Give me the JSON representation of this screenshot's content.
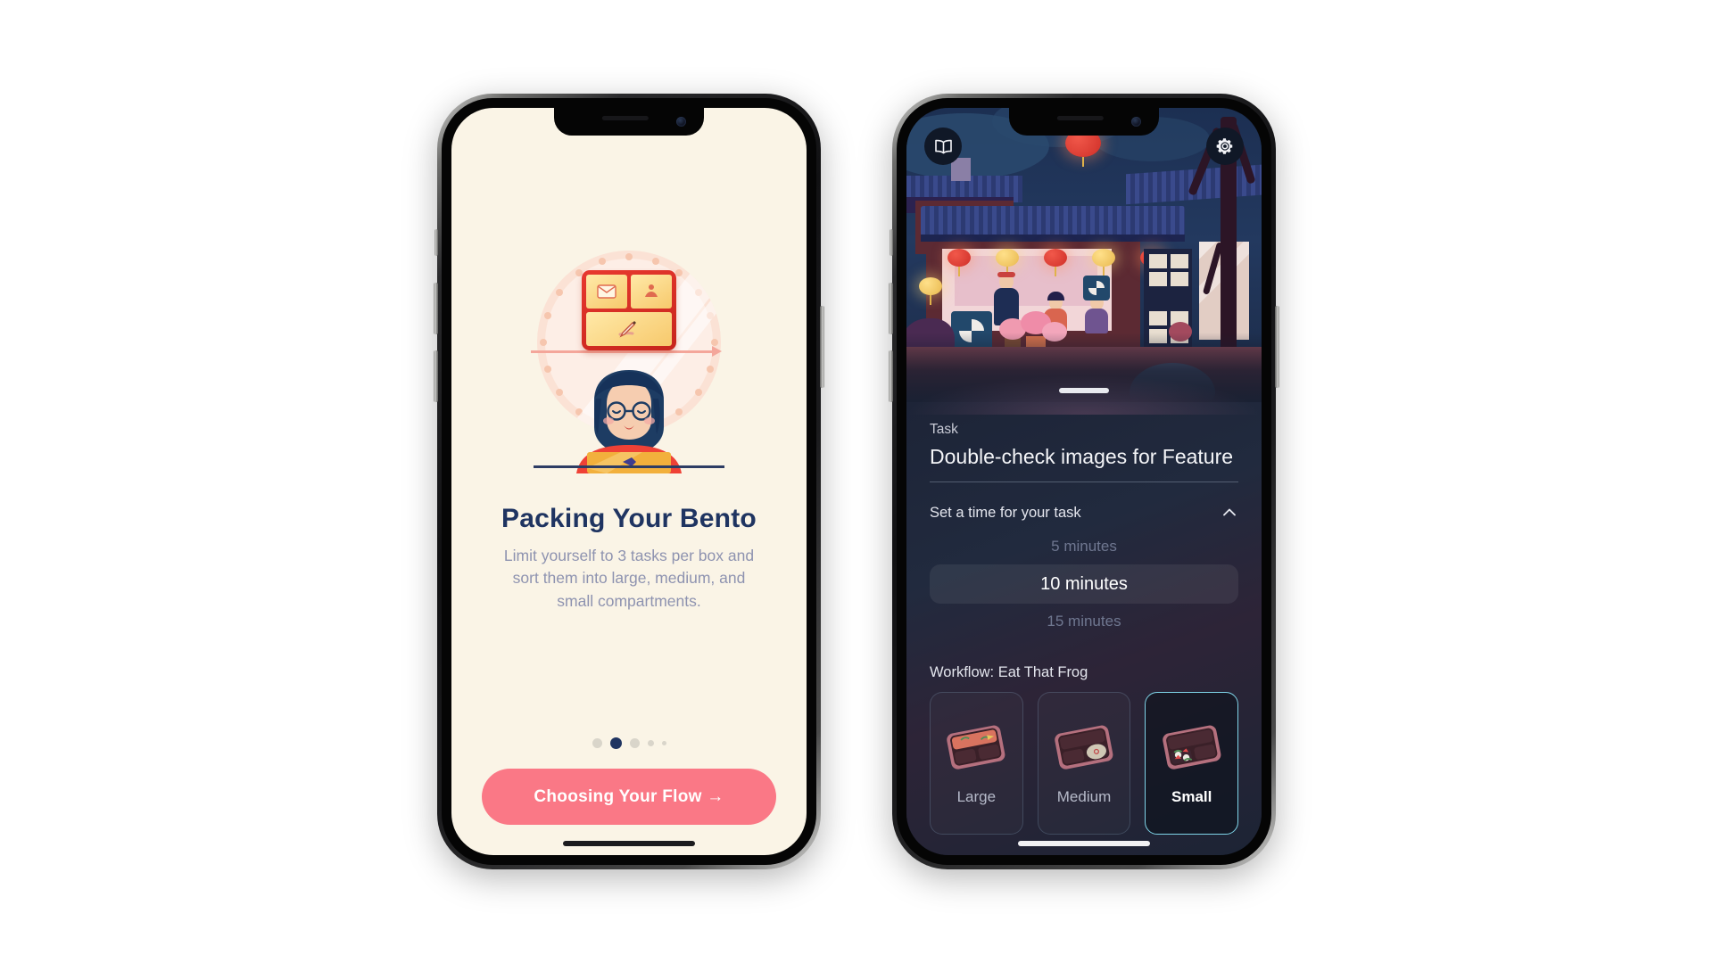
{
  "onboarding": {
    "title": "Packing Your Bento",
    "body": "Limit yourself to 3 tasks per box and sort them into large, medium, and small compartments.",
    "cta_label": "Choosing Your Flow  →",
    "pagination": {
      "total": 5,
      "active_index": 1,
      "dot_sizes": [
        11,
        13,
        11,
        7,
        5
      ]
    },
    "colors": {
      "background": "#faf4e6",
      "title": "#1f3461",
      "body": "#8e93b0",
      "cta_background": "#fa7886",
      "cta_text": "#ffffff",
      "dot_active": "#1f3461",
      "dot_inactive": "#d9d5ca"
    },
    "illustration": {
      "name": "woman-at-laptop-with-bento",
      "bento_compartments": [
        "envelope-icon",
        "meditation-icon",
        "writing-icon"
      ],
      "circle_color": "#fdeee6"
    }
  },
  "task_screen": {
    "top_bar": {
      "book_button": "book-icon",
      "settings_button": "gear-icon"
    },
    "scene_name": "night-izakaya-street",
    "sheet": {
      "task_label": "Task",
      "task_value": "Double-check images for Feature",
      "time_picker": {
        "label": "Set a time for your task",
        "collapse_icon": "chevron-up-icon",
        "expanded": true,
        "options": [
          "5 minutes",
          "10 minutes",
          "15 minutes"
        ],
        "selected": "10 minutes",
        "selected_index": 1
      },
      "workflow_label": "Workflow: Eat That Frog",
      "boxes": [
        {
          "label": "Large",
          "icon": "bento-box-large-icon",
          "selected": false
        },
        {
          "label": "Medium",
          "icon": "bento-box-medium-icon",
          "selected": false
        },
        {
          "label": "Small",
          "icon": "bento-box-small-icon",
          "selected": true
        }
      ]
    },
    "colors": {
      "sheet_background": "#212a3e",
      "accent_selected_border": "#7fd4e8",
      "label_text": "#e4e6ee",
      "muted_text": "#6f7790",
      "value_text": "#f4f5f8"
    }
  }
}
